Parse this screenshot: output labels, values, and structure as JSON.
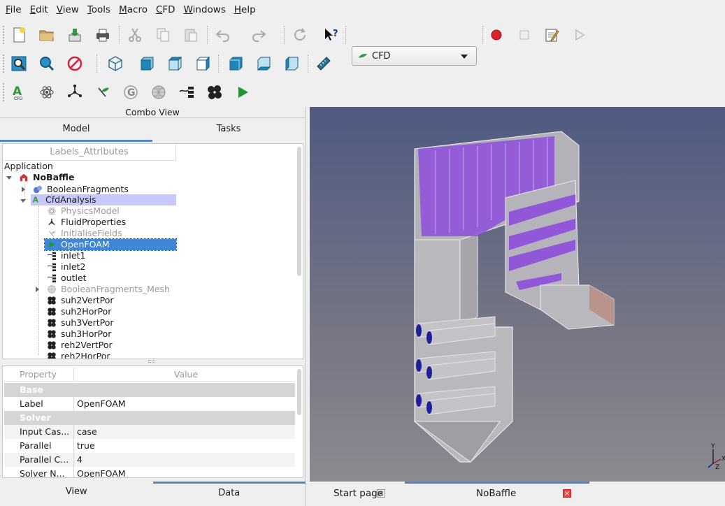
{
  "menu": [
    "File",
    "Edit",
    "View",
    "Tools",
    "Macro",
    "CFD",
    "Windows",
    "Help"
  ],
  "workbench_selector": {
    "value": "CFD"
  },
  "combo_view": {
    "title": "Combo View",
    "tabs": [
      "Model",
      "Tasks"
    ],
    "tree_header": "Labels_Attributes",
    "tree": {
      "root": "Application",
      "document": "NoBaffle",
      "items": [
        {
          "label": "BooleanFragments"
        },
        {
          "label": "CfdAnalysis"
        },
        {
          "label": "PhysicsModel"
        },
        {
          "label": "FluidProperties"
        },
        {
          "label": "InitialiseFields"
        },
        {
          "label": "OpenFOAM"
        },
        {
          "label": "inlet1"
        },
        {
          "label": "inlet2"
        },
        {
          "label": "outlet"
        },
        {
          "label": "BooleanFragments_Mesh"
        },
        {
          "label": "suh2VertPor"
        },
        {
          "label": "suh2HorPor"
        },
        {
          "label": "suh3VertPor"
        },
        {
          "label": "suh3HorPor"
        },
        {
          "label": "reh2VertPor"
        },
        {
          "label": "reh2HorPor"
        }
      ]
    },
    "properties": {
      "header": {
        "property": "Property",
        "value": "Value"
      },
      "groups": [
        {
          "name": "Base",
          "rows": [
            {
              "key": "Label",
              "value": "OpenFOAM"
            }
          ]
        },
        {
          "name": "Solver",
          "rows": [
            {
              "key": "Input Cas...",
              "value": "case"
            },
            {
              "key": "Parallel",
              "value": "true"
            },
            {
              "key": "Parallel C...",
              "value": "4"
            },
            {
              "key": "Solver N...",
              "value": "OpenFOAM"
            }
          ]
        }
      ]
    },
    "bottom_tabs": [
      "View",
      "Data"
    ]
  },
  "document_tabs": [
    {
      "label": "Start page"
    },
    {
      "label": "NoBaffle"
    }
  ],
  "axis": {
    "x": "X",
    "y": "Y",
    "z": "Z"
  },
  "colors": {
    "accent": "#4d89c7",
    "selection": "#3f86d7",
    "baffle": "#8a3fe0",
    "inlet": "#1e1e9a",
    "record": "#d8232a",
    "run": "#1a9a2a"
  }
}
